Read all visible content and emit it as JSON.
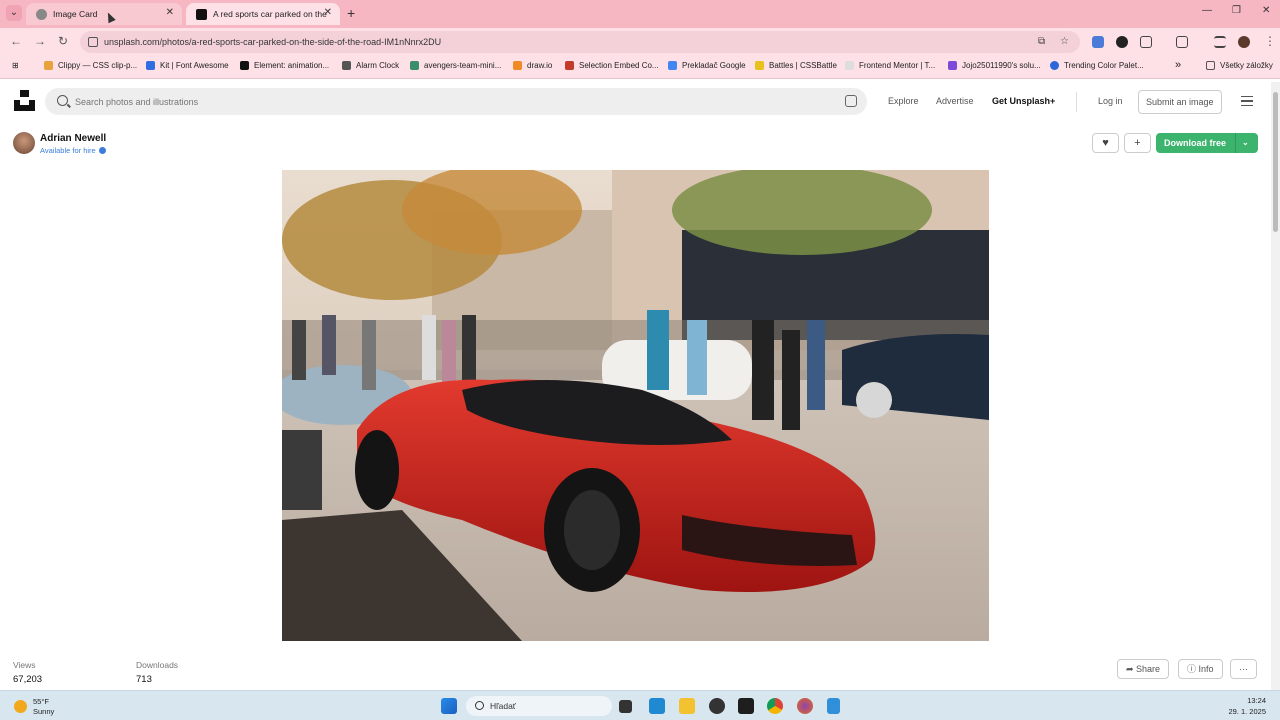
{
  "browser": {
    "tabs": [
      {
        "title": "Image Card"
      },
      {
        "title": "A red sports car parked on the"
      }
    ],
    "url": "unsplash.com/photos/a-red-sports-car-parked-on-the-side-of-the-road-IM1nNnrx2DU",
    "bookmarks": [
      "Clippy — CSS clip-p...",
      "Kit | Font Awesome",
      "Element: animation...",
      "Alarm Clock",
      "avengers-team-mini...",
      "draw.io",
      "Selection Embed Co...",
      "Prekladač Google",
      "Battles | CSSBattle",
      "Frontend Mentor | T...",
      "Jojo25011990's solu...",
      "Trending Color Palet..."
    ],
    "all_bookmarks": "Všetky záložky",
    "more_bookmarks": "»"
  },
  "header": {
    "search_placeholder": "Search photos and illustrations",
    "explore": "Explore",
    "advertise": "Advertise",
    "get_plus": "Get Unsplash+",
    "login": "Log in",
    "submit": "Submit an image"
  },
  "author": {
    "name": "Adrian Newell",
    "status": "Available for hire"
  },
  "actions": {
    "like_icon": "♥",
    "add_icon": "+",
    "download": "Download free",
    "download_chevron": "⌄"
  },
  "stats": {
    "views_label": "Views",
    "views": "67,203",
    "downloads_label": "Downloads",
    "downloads": "713",
    "share": "Share",
    "info": "Info",
    "more": "···"
  },
  "taskbar": {
    "temperature": "55°F",
    "weather": "Sunny",
    "search": "Hľadať",
    "time": "13:24",
    "date": "29. 1. 2025"
  }
}
